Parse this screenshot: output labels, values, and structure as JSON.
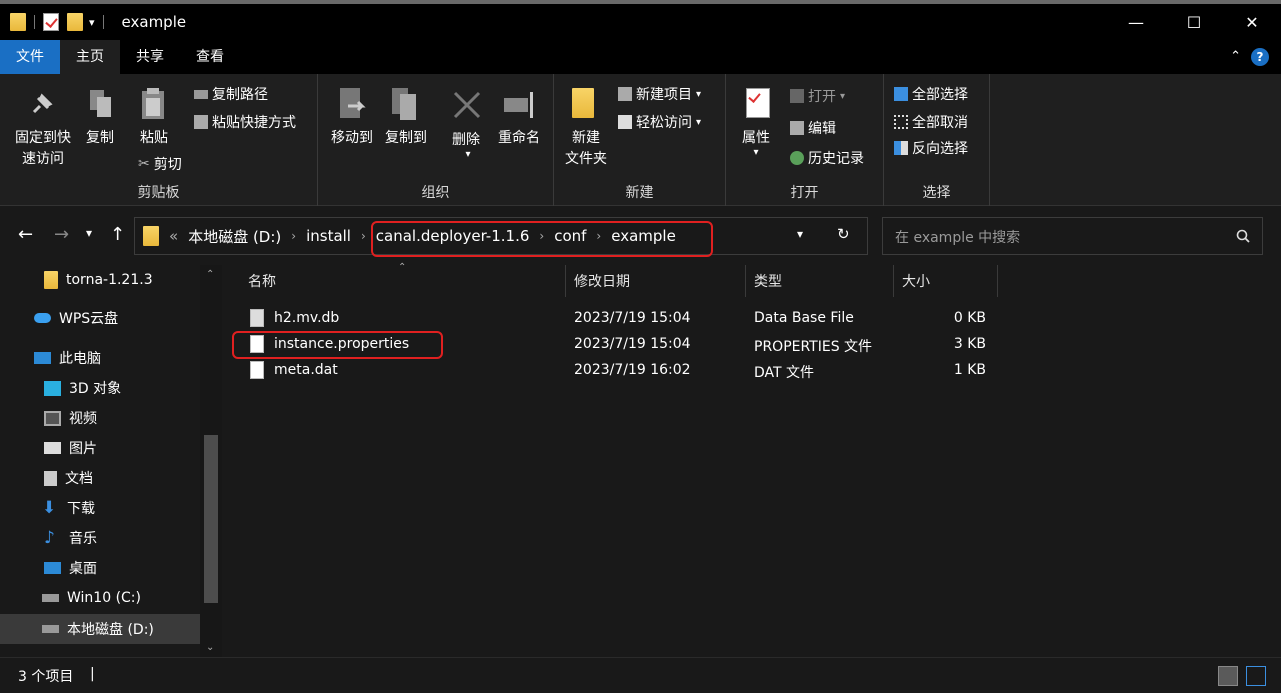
{
  "window": {
    "title": "example",
    "controls": {
      "minimize": "—",
      "maximize": "☐",
      "close": "✕"
    }
  },
  "ribbon_tabs": [
    {
      "label": "文件"
    },
    {
      "label": "主页"
    },
    {
      "label": "共享"
    },
    {
      "label": "查看"
    }
  ],
  "help": "?",
  "ribbon": {
    "clipboard": {
      "label": "剪贴板",
      "pin_line1": "固定到快",
      "pin_line2": "速访问",
      "copy": "复制",
      "paste": "粘贴",
      "copy_path": "复制路径",
      "paste_shortcut": "粘贴快捷方式",
      "cut": "剪切"
    },
    "organize": {
      "label": "组织",
      "move_to": "移动到",
      "copy_to": "复制到",
      "delete": "删除",
      "rename": "重命名"
    },
    "new": {
      "label": "新建",
      "new_folder_line1": "新建",
      "new_folder_line2": "文件夹",
      "new_item": "新建项目",
      "easy_access": "轻松访问"
    },
    "open": {
      "label": "打开",
      "properties": "属性",
      "open": "打开",
      "edit": "编辑",
      "history": "历史记录"
    },
    "select": {
      "label": "选择",
      "select_all": "全部选择",
      "select_none": "全部取消",
      "invert": "反向选择"
    }
  },
  "address": {
    "breadcrumb": [
      "«",
      "本地磁盘 (D:)",
      "install",
      "canal.deployer-1.1.6",
      "conf",
      "example"
    ],
    "search_placeholder": "在 example 中搜索"
  },
  "sidebar": {
    "items": [
      {
        "label": "torna-1.21.3",
        "icon": "folder-icon"
      },
      {
        "label": "WPS云盘",
        "icon": "cloud-icon"
      },
      {
        "label": "此电脑",
        "icon": "computer-icon"
      },
      {
        "label": "3D 对象",
        "icon": "3d-objects-icon"
      },
      {
        "label": "视频",
        "icon": "video-icon"
      },
      {
        "label": "图片",
        "icon": "pictures-icon"
      },
      {
        "label": "文档",
        "icon": "documents-icon"
      },
      {
        "label": "下载",
        "icon": "download-icon"
      },
      {
        "label": "音乐",
        "icon": "music-icon"
      },
      {
        "label": "桌面",
        "icon": "desktop-icon"
      },
      {
        "label": "Win10 (C:)",
        "icon": "drive-c-icon"
      },
      {
        "label": "本地磁盘 (D:)",
        "icon": "drive-d-icon"
      }
    ]
  },
  "columns": [
    "名称",
    "修改日期",
    "类型",
    "大小"
  ],
  "files": [
    {
      "name": "h2.mv.db",
      "date": "2023/7/19 15:04",
      "type": "Data Base File",
      "size": "0 KB"
    },
    {
      "name": "instance.properties",
      "date": "2023/7/19 15:04",
      "type": "PROPERTIES 文件",
      "size": "3 KB"
    },
    {
      "name": "meta.dat",
      "date": "2023/7/19 16:02",
      "type": "DAT 文件",
      "size": "1 KB"
    }
  ],
  "status": {
    "count": "3 个项目",
    "cursor": "|"
  },
  "colors": {
    "accent": "#1a6fc4",
    "highlight": "#e02020",
    "folder": "#f0c24f"
  }
}
